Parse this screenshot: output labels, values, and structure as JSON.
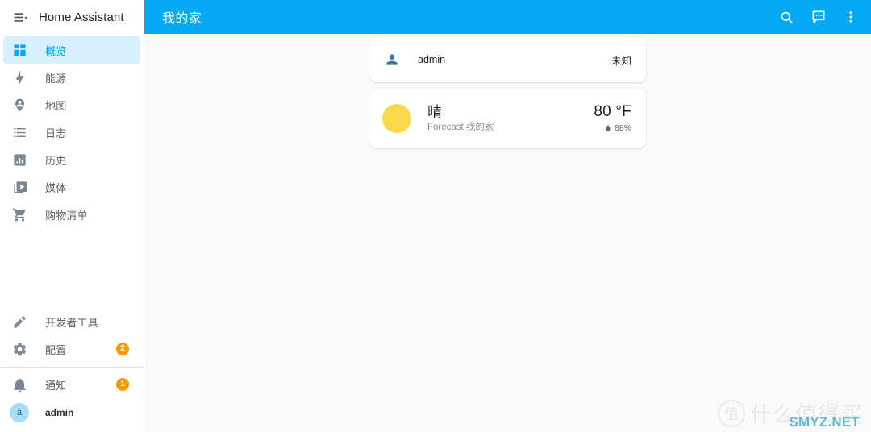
{
  "sidebar": {
    "menu_icon": "menu-open-icon",
    "title": "Home Assistant",
    "items": [
      {
        "label": "概览",
        "icon": "view-dashboard-icon",
        "active": true,
        "badge": null
      },
      {
        "label": "能源",
        "icon": "lightning-bolt-icon",
        "active": false,
        "badge": null
      },
      {
        "label": "地图",
        "icon": "map-marker-account-icon",
        "active": false,
        "badge": null
      },
      {
        "label": "日志",
        "icon": "format-list-bulleted-icon",
        "active": false,
        "badge": null
      },
      {
        "label": "历史",
        "icon": "chart-box-icon",
        "active": false,
        "badge": null
      },
      {
        "label": "媒体",
        "icon": "play-box-multiple-icon",
        "active": false,
        "badge": null
      },
      {
        "label": "购物清单",
        "icon": "cart-icon",
        "active": false,
        "badge": null
      }
    ],
    "tools": [
      {
        "label": "开发者工具",
        "icon": "hammer-wrench-icon",
        "badge": null
      },
      {
        "label": "配置",
        "icon": "cog-icon",
        "badge": "2"
      }
    ],
    "notifications": {
      "label": "通知",
      "icon": "bell-icon",
      "badge": "1"
    },
    "user": {
      "label": "admin",
      "avatar_initial": "a"
    },
    "badge_color": "#ff9800",
    "active_color": "#03a9f4"
  },
  "toolbar": {
    "title": "我的家",
    "background": "#03a9f4",
    "actions": [
      {
        "name": "search-icon",
        "label": "搜索"
      },
      {
        "name": "assist-icon",
        "label": "Assist"
      },
      {
        "name": "overflow-menu-icon",
        "label": "更多选项"
      }
    ]
  },
  "cards": {
    "person": {
      "icon": "account-icon",
      "name": "admin",
      "state": "未知"
    },
    "weather": {
      "icon": "weather-sunny-icon",
      "icon_color": "#fad74b",
      "condition": "晴",
      "secondary": "Forecast 我的家",
      "temperature": "80 °F",
      "humidity": "88%",
      "humidity_icon": "water-percent-icon"
    }
  },
  "watermark": {
    "mark": "值",
    "text": "什么值得买",
    "brand": "SMYZ.NET",
    "brand_color": "#67b7c9"
  }
}
